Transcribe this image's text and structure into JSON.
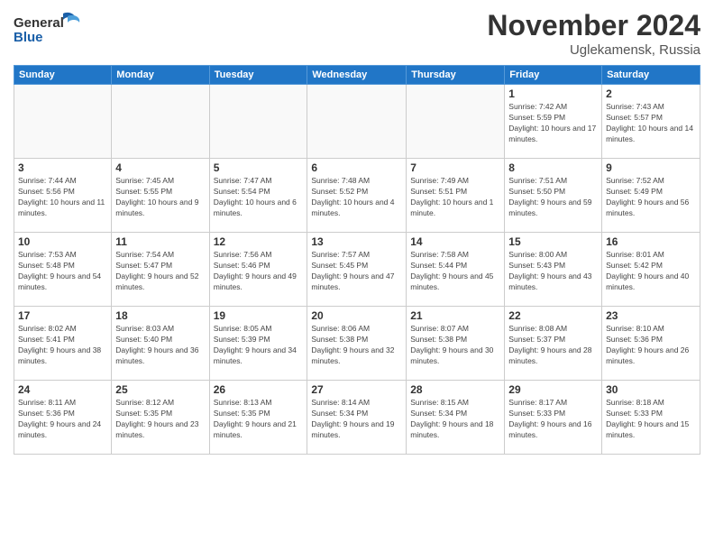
{
  "header": {
    "logo_general": "General",
    "logo_blue": "Blue",
    "month_title": "November 2024",
    "location": "Uglekamensk, Russia"
  },
  "days_of_week": [
    "Sunday",
    "Monday",
    "Tuesday",
    "Wednesday",
    "Thursday",
    "Friday",
    "Saturday"
  ],
  "weeks": [
    [
      {
        "day": "",
        "info": "",
        "empty": true
      },
      {
        "day": "",
        "info": "",
        "empty": true
      },
      {
        "day": "",
        "info": "",
        "empty": true
      },
      {
        "day": "",
        "info": "",
        "empty": true
      },
      {
        "day": "",
        "info": "",
        "empty": true
      },
      {
        "day": "1",
        "info": "Sunrise: 7:42 AM\nSunset: 5:59 PM\nDaylight: 10 hours and 17 minutes."
      },
      {
        "day": "2",
        "info": "Sunrise: 7:43 AM\nSunset: 5:57 PM\nDaylight: 10 hours and 14 minutes."
      }
    ],
    [
      {
        "day": "3",
        "info": "Sunrise: 7:44 AM\nSunset: 5:56 PM\nDaylight: 10 hours and 11 minutes."
      },
      {
        "day": "4",
        "info": "Sunrise: 7:45 AM\nSunset: 5:55 PM\nDaylight: 10 hours and 9 minutes."
      },
      {
        "day": "5",
        "info": "Sunrise: 7:47 AM\nSunset: 5:54 PM\nDaylight: 10 hours and 6 minutes."
      },
      {
        "day": "6",
        "info": "Sunrise: 7:48 AM\nSunset: 5:52 PM\nDaylight: 10 hours and 4 minutes."
      },
      {
        "day": "7",
        "info": "Sunrise: 7:49 AM\nSunset: 5:51 PM\nDaylight: 10 hours and 1 minute."
      },
      {
        "day": "8",
        "info": "Sunrise: 7:51 AM\nSunset: 5:50 PM\nDaylight: 9 hours and 59 minutes."
      },
      {
        "day": "9",
        "info": "Sunrise: 7:52 AM\nSunset: 5:49 PM\nDaylight: 9 hours and 56 minutes."
      }
    ],
    [
      {
        "day": "10",
        "info": "Sunrise: 7:53 AM\nSunset: 5:48 PM\nDaylight: 9 hours and 54 minutes."
      },
      {
        "day": "11",
        "info": "Sunrise: 7:54 AM\nSunset: 5:47 PM\nDaylight: 9 hours and 52 minutes."
      },
      {
        "day": "12",
        "info": "Sunrise: 7:56 AM\nSunset: 5:46 PM\nDaylight: 9 hours and 49 minutes."
      },
      {
        "day": "13",
        "info": "Sunrise: 7:57 AM\nSunset: 5:45 PM\nDaylight: 9 hours and 47 minutes."
      },
      {
        "day": "14",
        "info": "Sunrise: 7:58 AM\nSunset: 5:44 PM\nDaylight: 9 hours and 45 minutes."
      },
      {
        "day": "15",
        "info": "Sunrise: 8:00 AM\nSunset: 5:43 PM\nDaylight: 9 hours and 43 minutes."
      },
      {
        "day": "16",
        "info": "Sunrise: 8:01 AM\nSunset: 5:42 PM\nDaylight: 9 hours and 40 minutes."
      }
    ],
    [
      {
        "day": "17",
        "info": "Sunrise: 8:02 AM\nSunset: 5:41 PM\nDaylight: 9 hours and 38 minutes."
      },
      {
        "day": "18",
        "info": "Sunrise: 8:03 AM\nSunset: 5:40 PM\nDaylight: 9 hours and 36 minutes."
      },
      {
        "day": "19",
        "info": "Sunrise: 8:05 AM\nSunset: 5:39 PM\nDaylight: 9 hours and 34 minutes."
      },
      {
        "day": "20",
        "info": "Sunrise: 8:06 AM\nSunset: 5:38 PM\nDaylight: 9 hours and 32 minutes."
      },
      {
        "day": "21",
        "info": "Sunrise: 8:07 AM\nSunset: 5:38 PM\nDaylight: 9 hours and 30 minutes."
      },
      {
        "day": "22",
        "info": "Sunrise: 8:08 AM\nSunset: 5:37 PM\nDaylight: 9 hours and 28 minutes."
      },
      {
        "day": "23",
        "info": "Sunrise: 8:10 AM\nSunset: 5:36 PM\nDaylight: 9 hours and 26 minutes."
      }
    ],
    [
      {
        "day": "24",
        "info": "Sunrise: 8:11 AM\nSunset: 5:36 PM\nDaylight: 9 hours and 24 minutes."
      },
      {
        "day": "25",
        "info": "Sunrise: 8:12 AM\nSunset: 5:35 PM\nDaylight: 9 hours and 23 minutes."
      },
      {
        "day": "26",
        "info": "Sunrise: 8:13 AM\nSunset: 5:35 PM\nDaylight: 9 hours and 21 minutes."
      },
      {
        "day": "27",
        "info": "Sunrise: 8:14 AM\nSunset: 5:34 PM\nDaylight: 9 hours and 19 minutes."
      },
      {
        "day": "28",
        "info": "Sunrise: 8:15 AM\nSunset: 5:34 PM\nDaylight: 9 hours and 18 minutes."
      },
      {
        "day": "29",
        "info": "Sunrise: 8:17 AM\nSunset: 5:33 PM\nDaylight: 9 hours and 16 minutes."
      },
      {
        "day": "30",
        "info": "Sunrise: 8:18 AM\nSunset: 5:33 PM\nDaylight: 9 hours and 15 minutes."
      }
    ]
  ]
}
